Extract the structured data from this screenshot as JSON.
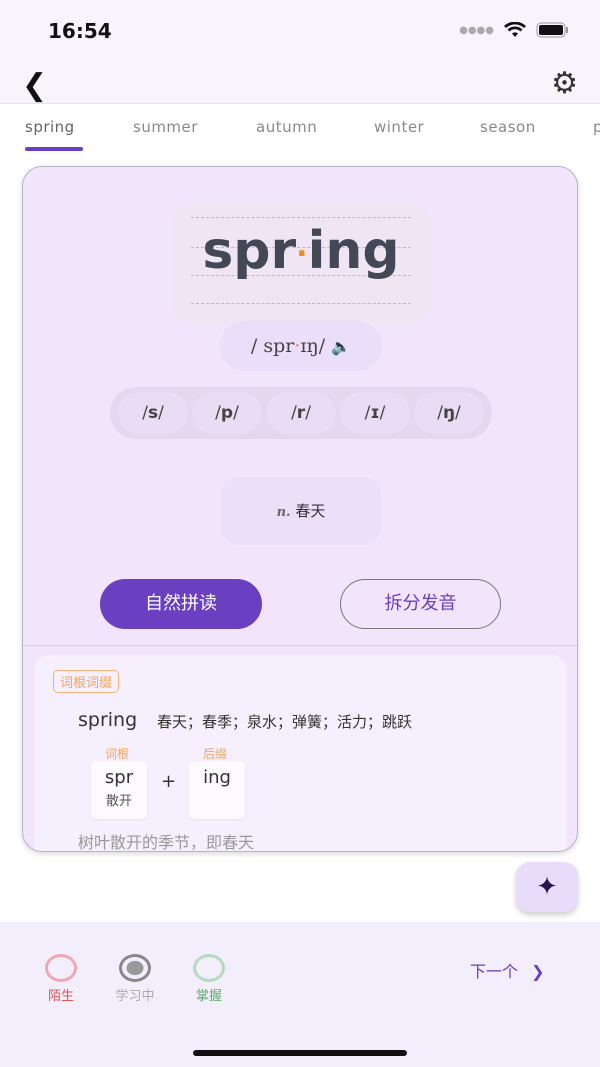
{
  "status": {
    "time": "16:54"
  },
  "tabs": [
    "spring",
    "summer",
    "autumn",
    "winter",
    "season",
    "p"
  ],
  "word": {
    "first": "spr",
    "dot": "·",
    "second": "ing",
    "ipa_open": "/ spr",
    "ipa_dot": "·",
    "ipa_close": "ɪŋ/",
    "phonemes": [
      "s",
      "p",
      "r",
      "ɪ",
      "ŋ"
    ],
    "pos": "n.",
    "meaning": "春天"
  },
  "buttons": {
    "phonics": "自然拼读",
    "split": "拆分发音"
  },
  "root": {
    "tag": "词根词缀",
    "word": "spring",
    "meanings": "春天；春季；泉水；弹簧；活力；跳跃",
    "root_label": "词根",
    "root": "spr",
    "root_meaning": "散开",
    "plus": "+",
    "suffix_label": "后缀",
    "suffix": "ing",
    "explanation": "树叶散开的季节，即春天"
  },
  "bottom": {
    "states": [
      {
        "label": "陌生",
        "color": "#e05555"
      },
      {
        "label": "学习中",
        "color": "#999999"
      },
      {
        "label": "掌握",
        "color": "#5aaa66"
      }
    ],
    "next": "下一个"
  },
  "colors": {
    "accent": "#6a3fc0",
    "highlight": "#f28c1e"
  }
}
